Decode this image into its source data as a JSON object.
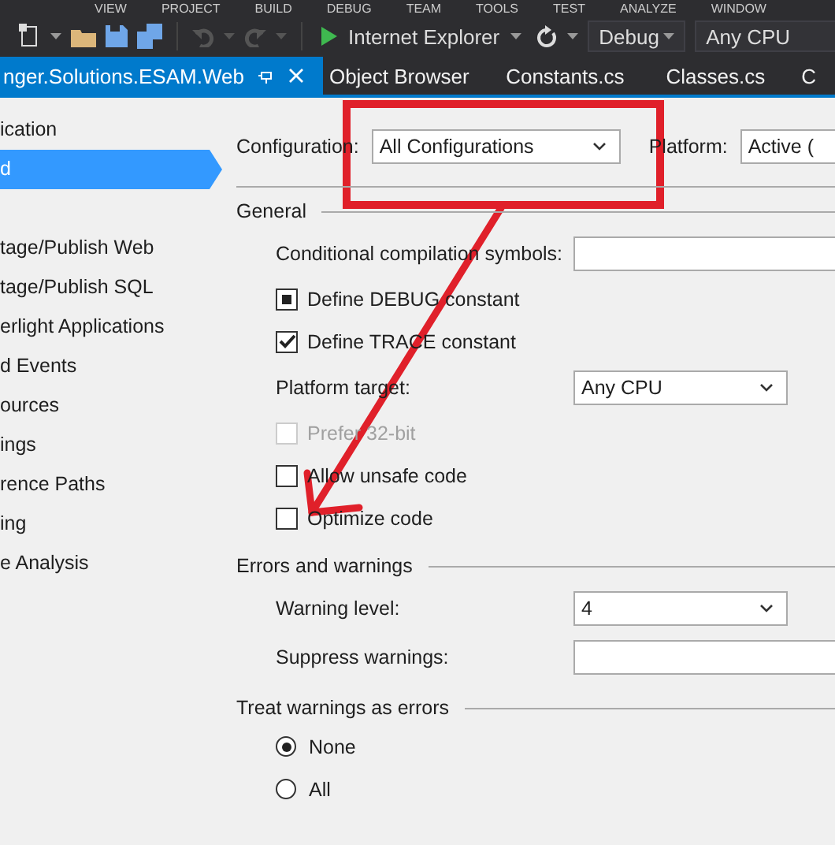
{
  "menu_bar": [
    "VIEW",
    "PROJECT",
    "BUILD",
    "DEBUG",
    "TEAM",
    "TOOLS",
    "TEST",
    "ANALYZE",
    "WINDOW"
  ],
  "toolbar": {
    "run_target": "Internet Explorer",
    "configuration": "Debug",
    "platform": "Any CPU"
  },
  "tabs": [
    {
      "label": "nger.Solutions.ESAM.Web",
      "selected": true
    },
    {
      "label": "Object Browser",
      "selected": false
    },
    {
      "label": "Constants.cs",
      "selected": false
    },
    {
      "label": "Classes.cs",
      "selected": false
    },
    {
      "label": "C",
      "selected": false
    }
  ],
  "sidebar": {
    "items": [
      {
        "label": "ication",
        "selected": false
      },
      {
        "label": "d",
        "selected": true
      },
      {
        "label": "tage/Publish Web",
        "selected": false
      },
      {
        "label": "tage/Publish SQL",
        "selected": false
      },
      {
        "label": "erlight Applications",
        "selected": false
      },
      {
        "label": "d Events",
        "selected": false
      },
      {
        "label": "ources",
        "selected": false
      },
      {
        "label": "ings",
        "selected": false
      },
      {
        "label": "rence Paths",
        "selected": false
      },
      {
        "label": "ing",
        "selected": false
      },
      {
        "label": "e Analysis",
        "selected": false
      }
    ]
  },
  "header": {
    "configuration_label": "Configuration:",
    "configuration": "All Configurations",
    "platform_label": "Platform:",
    "platform": "Active ("
  },
  "sections": [
    {
      "title": "General",
      "rows": [
        {
          "kind": "text",
          "label": "Conditional compilation symbols:",
          "value": ""
        },
        {
          "kind": "checkbox",
          "label": "Define DEBUG constant",
          "checked": true,
          "indeterminate": true,
          "disabled": false
        },
        {
          "kind": "checkbox",
          "label": "Define TRACE constant",
          "checked": true,
          "disabled": false
        },
        {
          "kind": "select",
          "label": "Platform target:",
          "value": "Any CPU"
        },
        {
          "kind": "checkbox",
          "label": "Prefer 32-bit",
          "checked": false,
          "disabled": true
        },
        {
          "kind": "checkbox",
          "label": "Allow unsafe code",
          "checked": false,
          "disabled": false
        },
        {
          "kind": "checkbox",
          "label": "Optimize code",
          "checked": false,
          "disabled": false
        }
      ]
    },
    {
      "title": "Errors and warnings",
      "rows": [
        {
          "kind": "select",
          "label": "Warning level:",
          "value": "4"
        },
        {
          "kind": "text",
          "label": "Suppress warnings:",
          "value": ""
        }
      ]
    },
    {
      "title": "Treat warnings as errors",
      "rows": [
        {
          "kind": "radio",
          "label": "None",
          "selected": true
        },
        {
          "kind": "radio",
          "label": "All",
          "selected": false
        }
      ]
    }
  ]
}
